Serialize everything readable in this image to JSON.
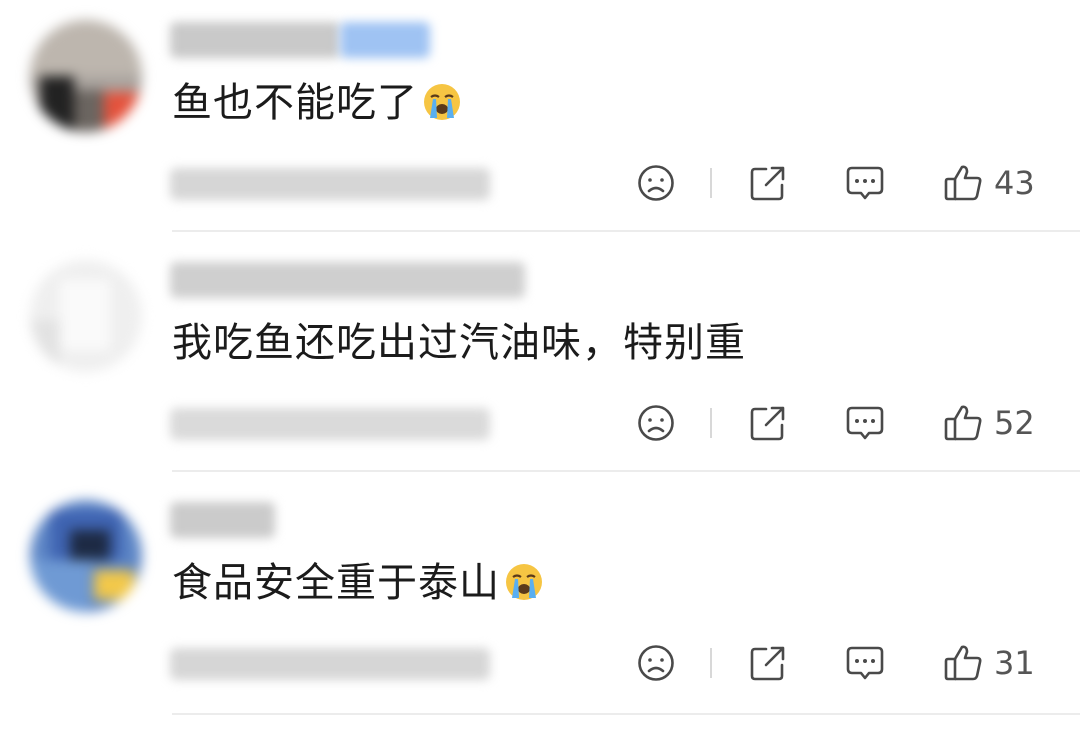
{
  "comments": [
    {
      "text": "鱼也不能吃了",
      "has_emoji": true,
      "emoji": "loudly-crying-face",
      "likes": "43"
    },
    {
      "text": "我吃鱼还吃出过汽油味，特别重",
      "has_emoji": false,
      "likes": "52"
    },
    {
      "text": "食品安全重于泰山",
      "has_emoji": true,
      "emoji": "loudly-crying-face",
      "likes": "31"
    }
  ],
  "colors": {
    "icon": "#4a4a4a",
    "separator": "#d8d8d8",
    "divider": "#ececec",
    "emoji_face": "#f6c543",
    "emoji_tears": "#5aaff0"
  },
  "icons": [
    "sad-face-icon",
    "share-icon",
    "comment-bubble-icon",
    "thumbs-up-icon"
  ]
}
